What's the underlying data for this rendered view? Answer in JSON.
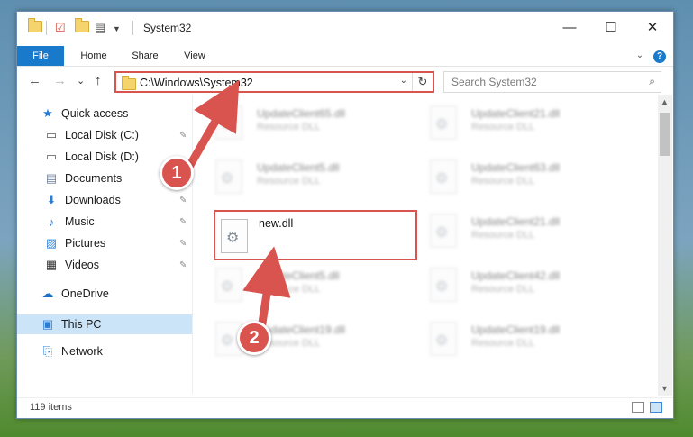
{
  "window": {
    "title": "System32",
    "controls": {
      "minimize": "—",
      "maximize": "☐",
      "close": "✕"
    }
  },
  "ribbon": {
    "tabs": [
      "File",
      "Home",
      "Share",
      "View"
    ],
    "expand_icon": "chevron-down-icon",
    "help_icon": "?"
  },
  "navigation": {
    "back_icon": "←",
    "forward_icon": "→",
    "recent_icon": "⌄",
    "up_icon": "↑"
  },
  "address_bar": {
    "path": "C:\\Windows\\System32",
    "dropdown_icon": "⌄",
    "refresh_icon": "↻",
    "highlight_color": "#d9534f"
  },
  "search": {
    "placeholder": "Search System32",
    "icon": "⌕"
  },
  "sidebar": {
    "items": [
      {
        "label": "Quick access",
        "icon": "★",
        "pinned": false
      },
      {
        "label": "Local Disk (C:)",
        "icon": "▭",
        "pinned": true
      },
      {
        "label": "Local Disk (D:)",
        "icon": "▭",
        "pinned": true
      },
      {
        "label": "Documents",
        "icon": "▤",
        "pinned": true
      },
      {
        "label": "Downloads",
        "icon": "⬇",
        "pinned": true
      },
      {
        "label": "Music",
        "icon": "♪",
        "pinned": true
      },
      {
        "label": "Pictures",
        "icon": "▨",
        "pinned": true
      },
      {
        "label": "Videos",
        "icon": "▦",
        "pinned": true
      },
      {
        "label": "OneDrive",
        "icon": "☁",
        "pinned": false
      },
      {
        "label": "This PC",
        "icon": "▣",
        "pinned": false,
        "selected": true
      },
      {
        "label": "Network",
        "icon": "⎘",
        "pinned": false
      }
    ],
    "pin_icon": "📌"
  },
  "files": {
    "left_column": [
      {
        "name": "UpdateClient65.dll",
        "type": "Resource DLL"
      },
      {
        "name": "UpdateClient5.dll",
        "type": "Resource DLL"
      },
      {
        "name": "UpdateClient5.dll",
        "type": "Resource DLL"
      },
      {
        "name": "UpdateClient19.dll",
        "type": "Resource DLL"
      }
    ],
    "right_column": [
      {
        "name": "UpdateClient21.dll",
        "type": "Resource DLL"
      },
      {
        "name": "UpdateClient63.dll",
        "type": "Resource DLL"
      },
      {
        "name": "UpdateClient21.dll",
        "type": "Resource DLL"
      },
      {
        "name": "UpdateClient42.dll",
        "type": "Resource DLL"
      },
      {
        "name": "UpdateClient19.dll",
        "type": "Resource DLL"
      }
    ],
    "highlighted": {
      "name": "new.dll"
    }
  },
  "status_bar": {
    "item_count": "119 items"
  },
  "callouts": [
    {
      "number": "1",
      "color": "#d9534f"
    },
    {
      "number": "2",
      "color": "#d9534f"
    }
  ]
}
